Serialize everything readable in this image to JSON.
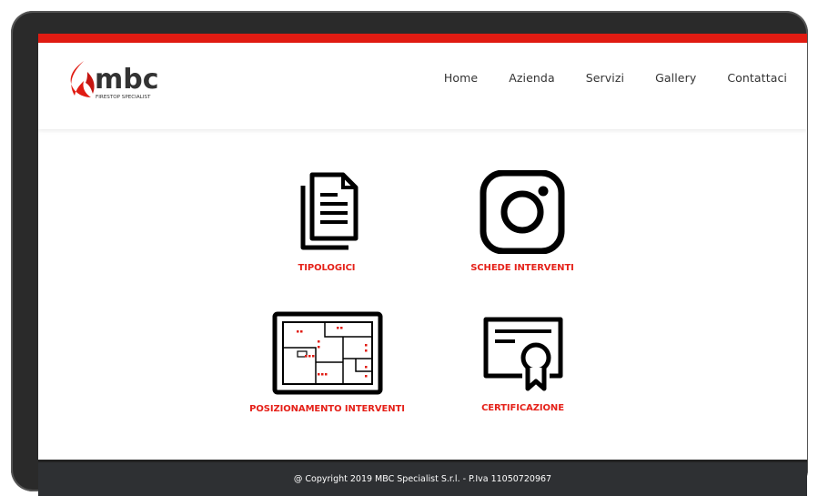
{
  "brand": {
    "name": "mbc",
    "tagline": "FIRESTOP SPECIALIST",
    "accent": "#e01b12"
  },
  "nav": {
    "items": [
      {
        "label": "Home"
      },
      {
        "label": "Azienda"
      },
      {
        "label": "Servizi"
      },
      {
        "label": "Gallery"
      },
      {
        "label": "Contattaci"
      }
    ]
  },
  "tiles": [
    {
      "label": "TIPOLOGICI",
      "icon": "documents-icon"
    },
    {
      "label": "SCHEDE INTERVENTI",
      "icon": "instagram-icon"
    },
    {
      "label": "POSIZIONAMENTO INTERVENTI",
      "icon": "floorplan-icon"
    },
    {
      "label": "CERTIFICAZIONE",
      "icon": "certificate-icon"
    }
  ],
  "footer": {
    "text": "@ Copyright 2019 MBC Specialist S.r.l. - P.Iva 11050720967"
  }
}
